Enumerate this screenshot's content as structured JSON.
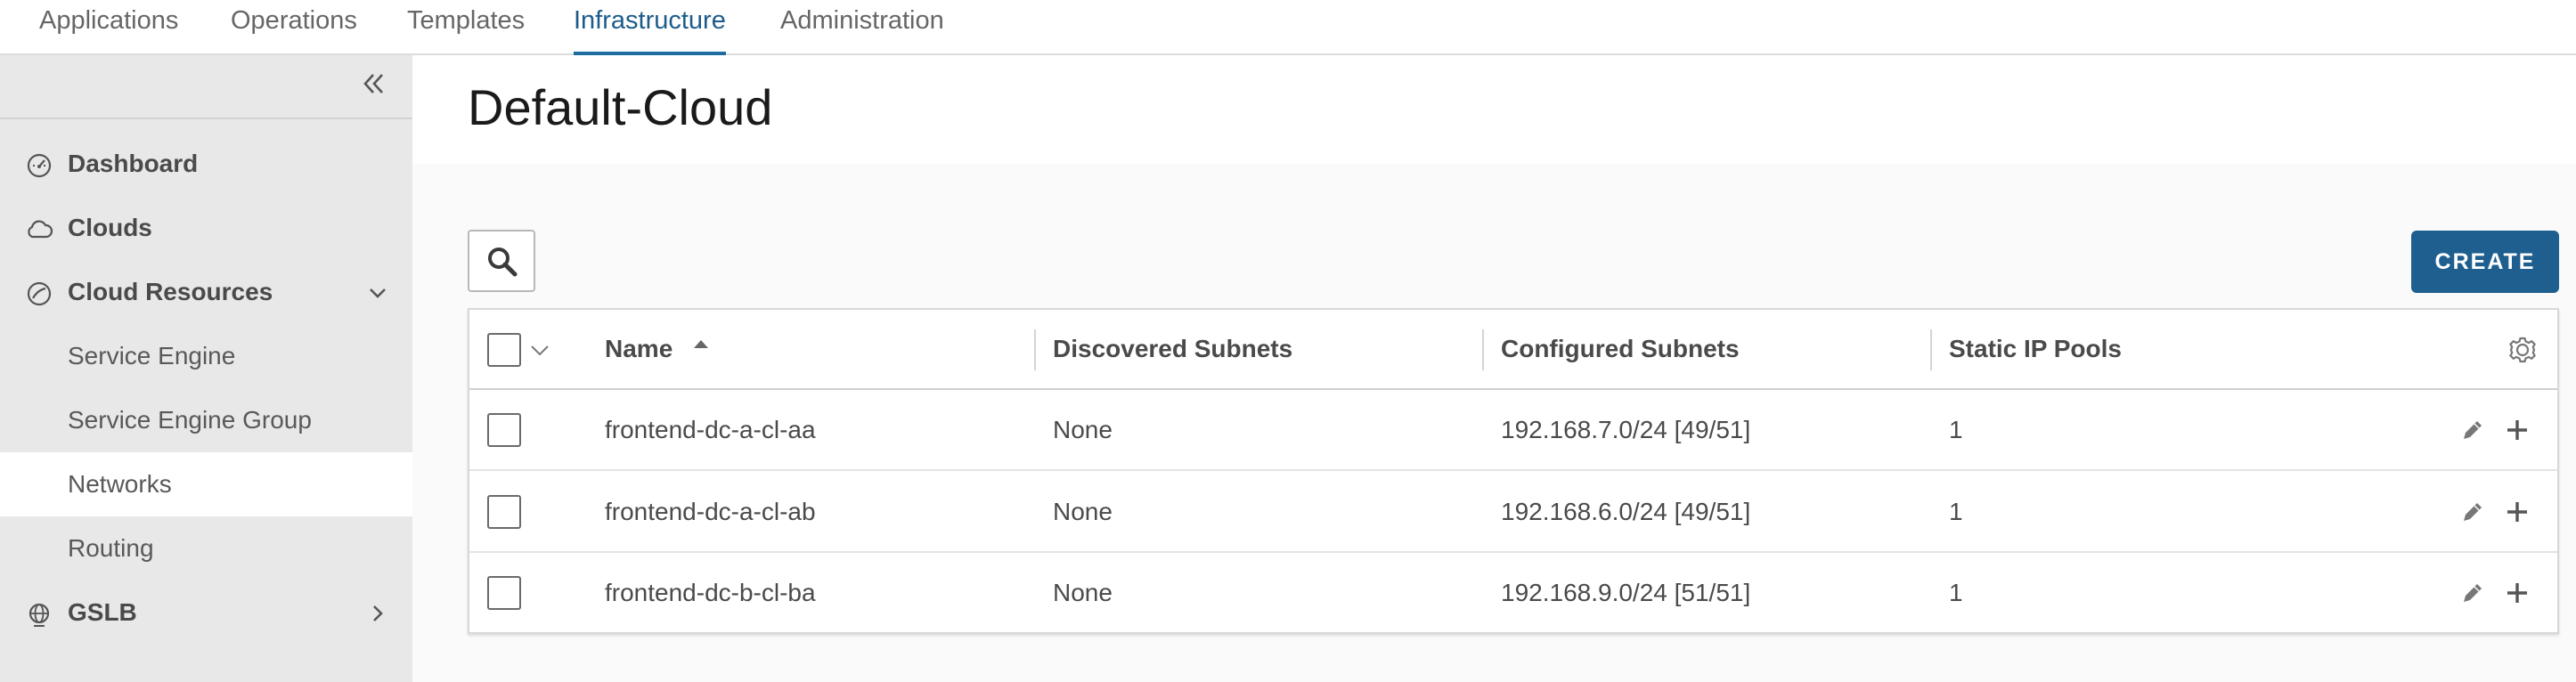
{
  "topnav": {
    "tabs": [
      {
        "label": "Applications",
        "active": false
      },
      {
        "label": "Operations",
        "active": false
      },
      {
        "label": "Templates",
        "active": false
      },
      {
        "label": "Infrastructure",
        "active": true
      },
      {
        "label": "Administration",
        "active": false
      }
    ]
  },
  "sidebar": {
    "collapse_icon": "double-chevron-left-icon",
    "items": [
      {
        "label": "Dashboard",
        "icon": "dashboard-icon",
        "level": "top"
      },
      {
        "label": "Clouds",
        "icon": "cloud-icon",
        "level": "top"
      },
      {
        "label": "Cloud Resources",
        "icon": "cloud-resources-icon",
        "level": "top",
        "expanded": true
      },
      {
        "label": "Service Engine",
        "level": "sub"
      },
      {
        "label": "Service Engine Group",
        "level": "sub"
      },
      {
        "label": "Networks",
        "level": "sub",
        "selected": true
      },
      {
        "label": "Routing",
        "level": "sub"
      },
      {
        "label": "GSLB",
        "icon": "globe-icon",
        "level": "top",
        "expanded": false
      }
    ]
  },
  "main": {
    "title": "Default-Cloud",
    "create_label": "CREATE",
    "grid": {
      "columns": [
        "Name",
        "Discovered Subnets",
        "Configured Subnets",
        "Static IP Pools"
      ],
      "sort_column": "Name",
      "sort_direction": "ascending",
      "rows": [
        {
          "name": "frontend-dc-a-cl-aa",
          "discovered": "None",
          "configured": "192.168.7.0/24 [49/51]",
          "static_pools": "1"
        },
        {
          "name": "frontend-dc-a-cl-ab",
          "discovered": "None",
          "configured": "192.168.6.0/24 [49/51]",
          "static_pools": "1"
        },
        {
          "name": "frontend-dc-b-cl-ba",
          "discovered": "None",
          "configured": "192.168.9.0/24 [51/51]",
          "static_pools": "1"
        }
      ]
    }
  },
  "colors": {
    "accent": "#1e5f8f",
    "active_tab": "#1d5c8a",
    "sidebar_bg": "#e8e8e8",
    "selected_item_bg": "#ffffff"
  }
}
